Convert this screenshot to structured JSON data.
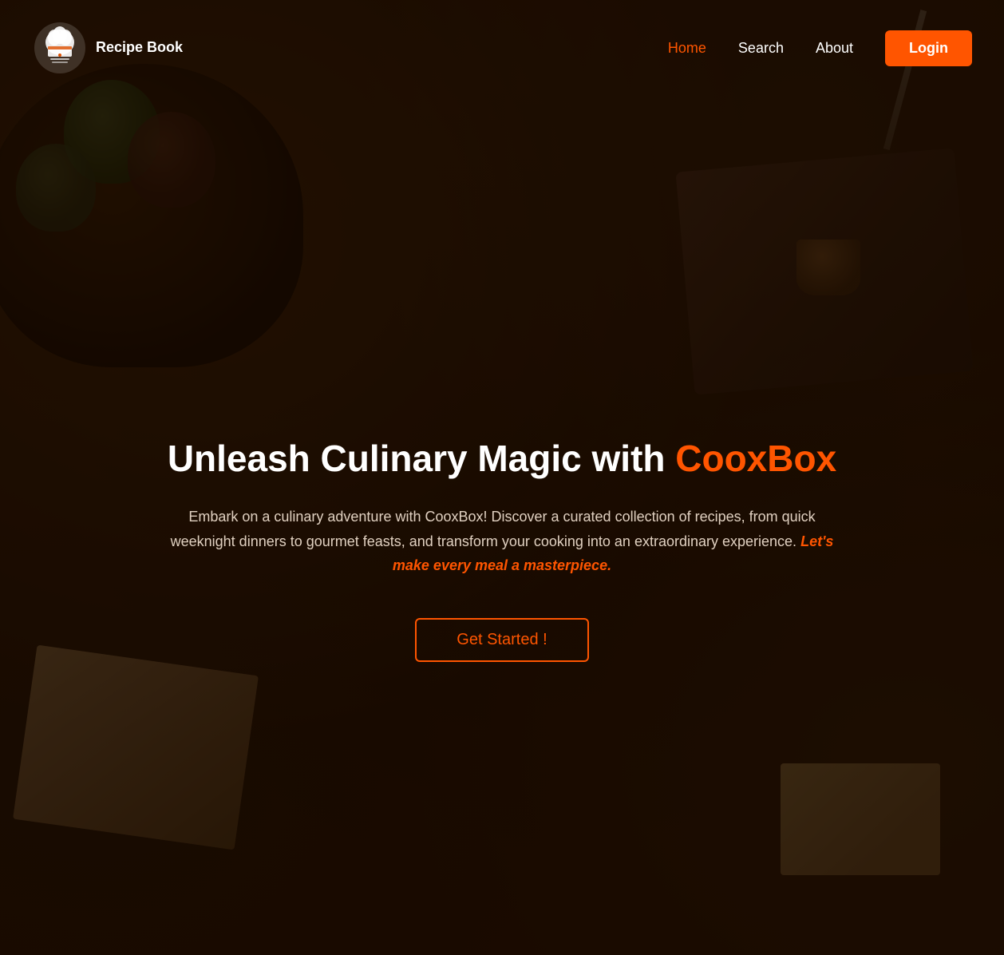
{
  "site": {
    "name": "Recipe Book",
    "tagline": "Recipe Book"
  },
  "navbar": {
    "logo_text": "Recipe Book",
    "nav_items": [
      {
        "label": "Home",
        "active": true
      },
      {
        "label": "Search",
        "active": false
      },
      {
        "label": "About",
        "active": false
      }
    ],
    "login_label": "Login"
  },
  "hero": {
    "title_part1": "Unleash Culinary Magic with ",
    "title_highlight": "CooxBox",
    "description": "Embark on a culinary adventure with CooxBox! Discover a curated collection of recipes, from quick weeknight dinners to gourmet feasts, and transform your cooking into an extraordinary experience.",
    "cta_text": "Let's make every meal a masterpiece.",
    "button_label": "Get Started !"
  },
  "colors": {
    "accent": "#ff5500",
    "white": "#ffffff",
    "dark_bg": "#2d1500",
    "text_light": "#e0d0c0"
  }
}
